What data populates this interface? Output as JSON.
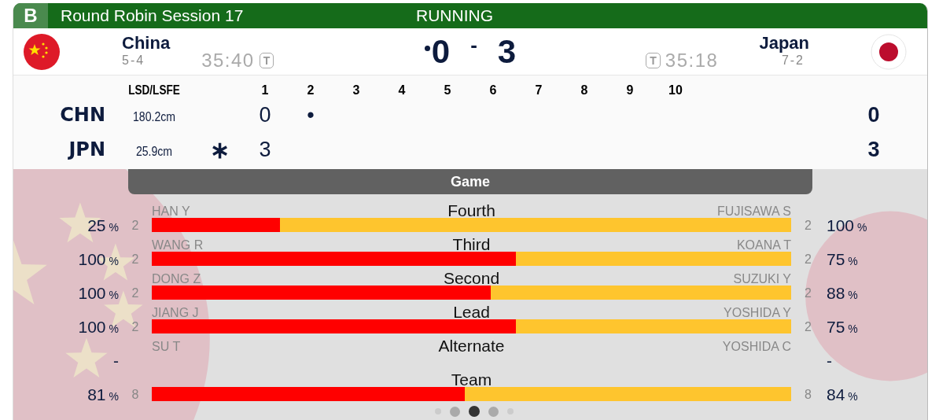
{
  "header": {
    "badge": "B",
    "title": "Round Robin Session 17",
    "status": "RUNNING"
  },
  "teams": [
    {
      "name": "China",
      "record": "5-4",
      "time": "35:40",
      "timeout": "T",
      "score": "0",
      "hammer": true
    },
    {
      "name": "Japan",
      "record": "7-2",
      "time": "35:18",
      "timeout": "T",
      "score": "3",
      "hammer": false
    }
  ],
  "score_separator": "-",
  "ends": {
    "lsd_label": "LSD/LSFE",
    "numbers": [
      "1",
      "2",
      "3",
      "4",
      "5",
      "6",
      "7",
      "8",
      "9",
      "10"
    ],
    "rows": [
      {
        "team": "CHN",
        "lsd": "180.2cm",
        "scores": [
          "0",
          "•"
        ],
        "total": "0"
      },
      {
        "team": "JPN",
        "lsd": "25.9cm",
        "lsfe": "∗",
        "scores": [
          "3"
        ],
        "total": "3"
      }
    ]
  },
  "game": {
    "title": "Game",
    "rows": [
      {
        "position": "Fourth",
        "kind": "bar",
        "level": 0.2,
        "left": {
          "name": "HAN Y",
          "count": "2",
          "pct": "25",
          "unit": "%"
        },
        "right": {
          "name": "FUJISAWA S",
          "count": "2",
          "pct": "100",
          "unit": "%"
        }
      },
      {
        "position": "Third",
        "kind": "bar",
        "level": 0.57,
        "left": {
          "name": "WANG R",
          "count": "2",
          "pct": "100",
          "unit": "%"
        },
        "right": {
          "name": "KOANA T",
          "count": "2",
          "pct": "75",
          "unit": "%"
        }
      },
      {
        "position": "Second",
        "kind": "bar",
        "level": 0.53,
        "left": {
          "name": "DONG Z",
          "count": "2",
          "pct": "100",
          "unit": "%"
        },
        "right": {
          "name": "SUZUKI Y",
          "count": "2",
          "pct": "88",
          "unit": "%"
        }
      },
      {
        "position": "Lead",
        "kind": "bar",
        "level": 0.57,
        "left": {
          "name": "JIANG J",
          "count": "2",
          "pct": "100",
          "unit": "%"
        },
        "right": {
          "name": "YOSHIDA Y",
          "count": "2",
          "pct": "75",
          "unit": "%"
        }
      },
      {
        "position": "Alternate",
        "kind": "none",
        "left": {
          "name": "SU T",
          "pct": "-"
        },
        "right": {
          "name": "YOSHIDA C",
          "pct": "-"
        }
      },
      {
        "position": "Team",
        "kind": "bar",
        "level": 0.49,
        "left": {
          "count": "8",
          "pct": "81",
          "unit": "%"
        },
        "right": {
          "count": "8",
          "pct": "84",
          "unit": "%"
        }
      }
    ]
  },
  "pager": [
    {
      "selected": false
    },
    {
      "selected": false
    },
    {
      "selected": true
    },
    {
      "selected": false
    },
    {
      "selected": false
    }
  ]
}
